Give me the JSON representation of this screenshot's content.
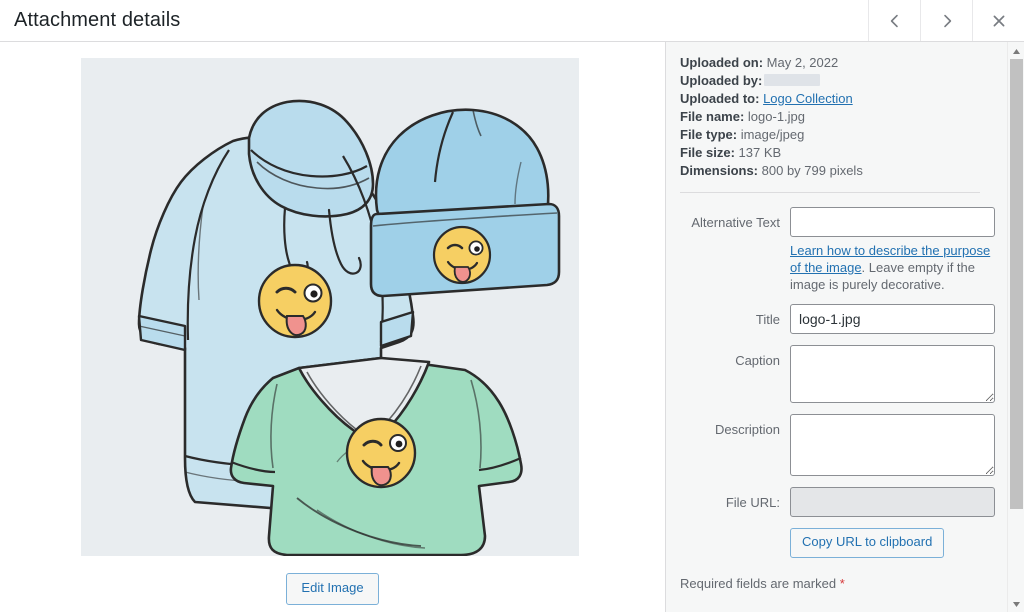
{
  "header": {
    "title": "Attachment details",
    "prev_icon": "chevron-left-icon",
    "next_icon": "chevron-right-icon",
    "close_icon": "close-icon"
  },
  "preview": {
    "edit_image_label": "Edit Image",
    "alt_description": "Hand-drawn illustration of a light blue hoodie, a blue beanie and a green v-neck t-shirt, each printed with a yellow winking face emoji sticking out its tongue",
    "background_color": "#e9edf0"
  },
  "meta": {
    "uploaded_on_label": "Uploaded on:",
    "uploaded_on_value": "May 2, 2022",
    "uploaded_by_label": "Uploaded by:",
    "uploaded_by_value": "",
    "uploaded_to_label": "Uploaded to:",
    "uploaded_to_value": "Logo Collection",
    "file_name_label": "File name:",
    "file_name_value": "logo-1.jpg",
    "file_type_label": "File type:",
    "file_type_value": "image/jpeg",
    "file_size_label": "File size:",
    "file_size_value": "137 KB",
    "dimensions_label": "Dimensions:",
    "dimensions_value": "800 by 799 pixels"
  },
  "form": {
    "alt_text_label": "Alternative Text",
    "alt_text_value": "",
    "alt_text_placeholder": "",
    "helper_link": "Learn how to describe the purpose of the image",
    "helper_rest": ". Leave empty if the image is purely decorative.",
    "title_label": "Title",
    "title_value": "logo-1.jpg",
    "caption_label": "Caption",
    "caption_value": "",
    "description_label": "Description",
    "description_value": "",
    "file_url_label": "File URL:",
    "file_url_value": "",
    "copy_url_label": "Copy URL to clipboard",
    "required_note": "Required fields are marked ",
    "required_star": "*"
  },
  "colors": {
    "accent": "#2271b1",
    "sidebar_bg": "#f6f7f7",
    "required_star": "#d63638"
  }
}
